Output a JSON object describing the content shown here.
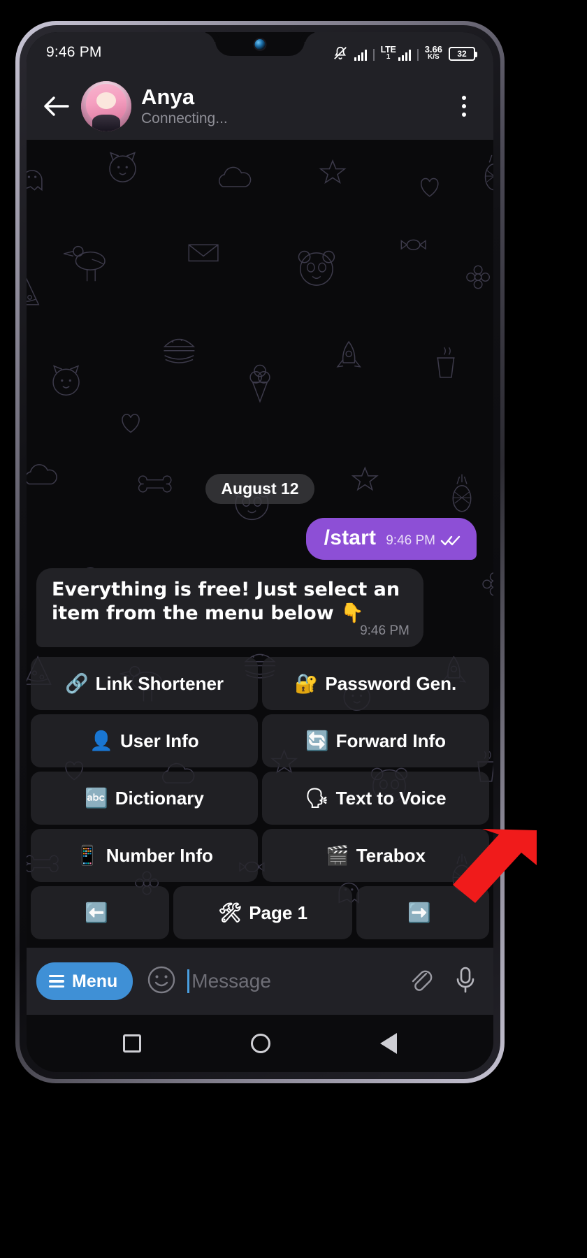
{
  "statusbar": {
    "time": "9:46 PM",
    "network": "LTE",
    "network_sub": "1",
    "data_speed_value": "3.66",
    "data_speed_unit": "K/S",
    "battery": "32",
    "icons": [
      "bell-muted-icon",
      "signal-bars-icon",
      "lte-signal-icon",
      "data-speed-indicator",
      "battery-icon"
    ]
  },
  "header": {
    "back_icon": "back-arrow-icon",
    "avatar": "contact-avatar",
    "title": "Anya",
    "subtitle": "Connecting...",
    "menu_icon": "kebab-menu-icon"
  },
  "chat": {
    "date_separator": "August 12",
    "messages": [
      {
        "id": "outgoing-start",
        "direction": "out",
        "text": "/start",
        "time": "9:46 PM",
        "status_icon": "double-check-icon",
        "bubble_color": "#8d4fd6"
      },
      {
        "id": "incoming-menu-intro",
        "direction": "in",
        "text": "Everything is free! Just select an item from the menu below 👇",
        "time": "9:46 PM",
        "bubble_color": "#222226"
      }
    ]
  },
  "keyboard": {
    "rows": [
      [
        {
          "icon": "🔗",
          "icon_name": "link-icon",
          "label": "Link Shortener"
        },
        {
          "icon": "🔐",
          "icon_name": "locked-with-key-icon",
          "label": "Password Gen."
        }
      ],
      [
        {
          "icon": "👤",
          "icon_name": "bust-in-silhouette-icon",
          "label": "User Info"
        },
        {
          "icon": "🔄",
          "icon_name": "forward-arrow-icon",
          "label": "Forward Info"
        }
      ],
      [
        {
          "icon": "🔤",
          "icon_name": "abcd-icon",
          "label": "Dictionary"
        },
        {
          "icon": "🗣",
          "icon_name": "speaking-head-icon",
          "label": "Text to Voice"
        }
      ],
      [
        {
          "icon": "📱",
          "icon_name": "mobile-phone-icon",
          "label": "Number Info"
        },
        {
          "icon": "🎬",
          "icon_name": "clapper-board-icon",
          "label": "Terabox"
        }
      ]
    ],
    "nav_row": [
      {
        "icon": "⬅️",
        "icon_name": "arrow-left-icon",
        "label": ""
      },
      {
        "icon": "🛠",
        "icon_name": "hammer-and-wrench-icon",
        "label": "Page 1"
      },
      {
        "icon": "➡️",
        "icon_name": "arrow-right-icon",
        "label": ""
      }
    ]
  },
  "input_bar": {
    "menu_label": "Menu",
    "menu_icon": "hamburger-icon",
    "emoji_icon": "smiley-icon",
    "message_value": "",
    "message_placeholder": "Message",
    "attach_icon": "paperclip-icon",
    "voice_icon": "microphone-icon",
    "accent_color": "#3f90d6"
  },
  "navbar": {
    "recents": "square-icon",
    "home": "circle-icon",
    "back": "triangle-back-icon"
  },
  "annotation": {
    "type": "red-arrow",
    "points_to": "next-page-button",
    "color": "#f01b1b"
  }
}
